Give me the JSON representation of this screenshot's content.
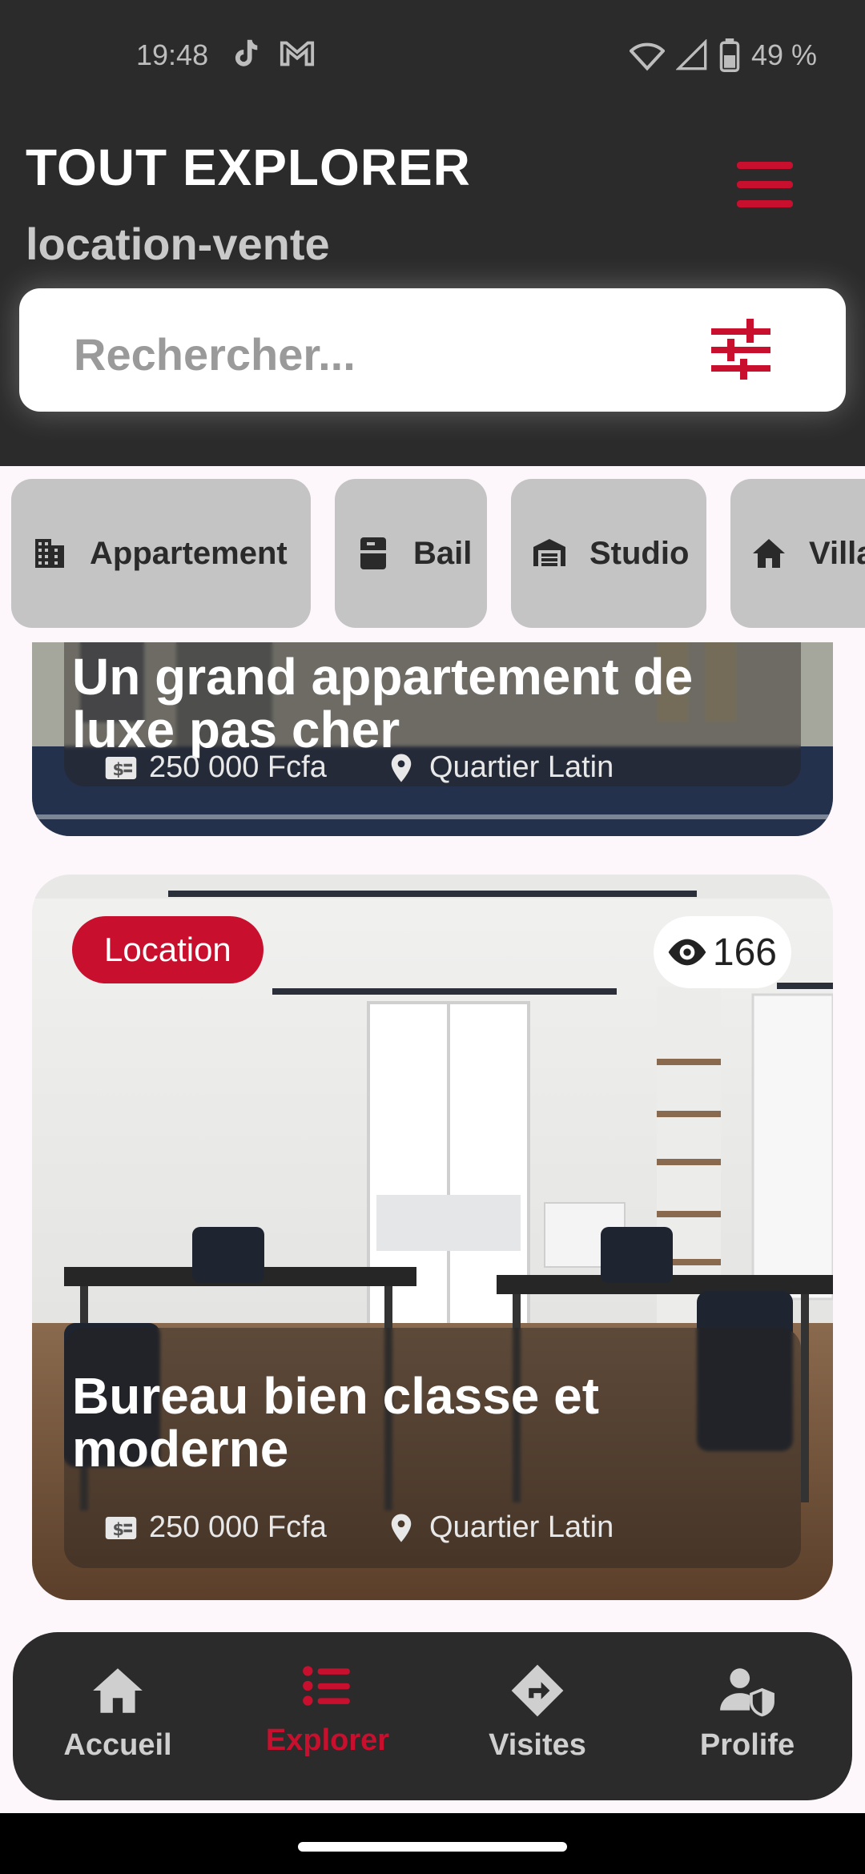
{
  "status_bar": {
    "time": "19:48",
    "battery": "49 %"
  },
  "header": {
    "title": "TOUT EXPLORER",
    "subtitle": "location-vente"
  },
  "search": {
    "placeholder": "Rechercher..."
  },
  "categories": [
    {
      "label": "Appartement",
      "icon": "building-icon"
    },
    {
      "label": "Bail",
      "icon": "cabinet-icon"
    },
    {
      "label": "Studio",
      "icon": "warehouse-icon"
    },
    {
      "label": "Villa",
      "icon": "home-icon"
    }
  ],
  "listings": [
    {
      "title": "Un grand appartement de luxe pas cher",
      "price": "250 000 Fcfa",
      "location": "Quartier Latin"
    },
    {
      "badge": "Location",
      "views": "166",
      "title": "Bureau bien classe et moderne",
      "price": "250 000 Fcfa",
      "location": "Quartier Latin"
    }
  ],
  "bottom_nav": [
    {
      "label": "Accueil",
      "icon": "home-icon"
    },
    {
      "label": "Explorer",
      "icon": "list-icon",
      "active": true
    },
    {
      "label": "Visites",
      "icon": "directions-icon"
    },
    {
      "label": "Prolife",
      "icon": "user-shield-icon"
    }
  ],
  "colors": {
    "accent": "#c8102e",
    "header_bg": "#2b2b2b",
    "chip_bg": "#c4c4c4"
  }
}
